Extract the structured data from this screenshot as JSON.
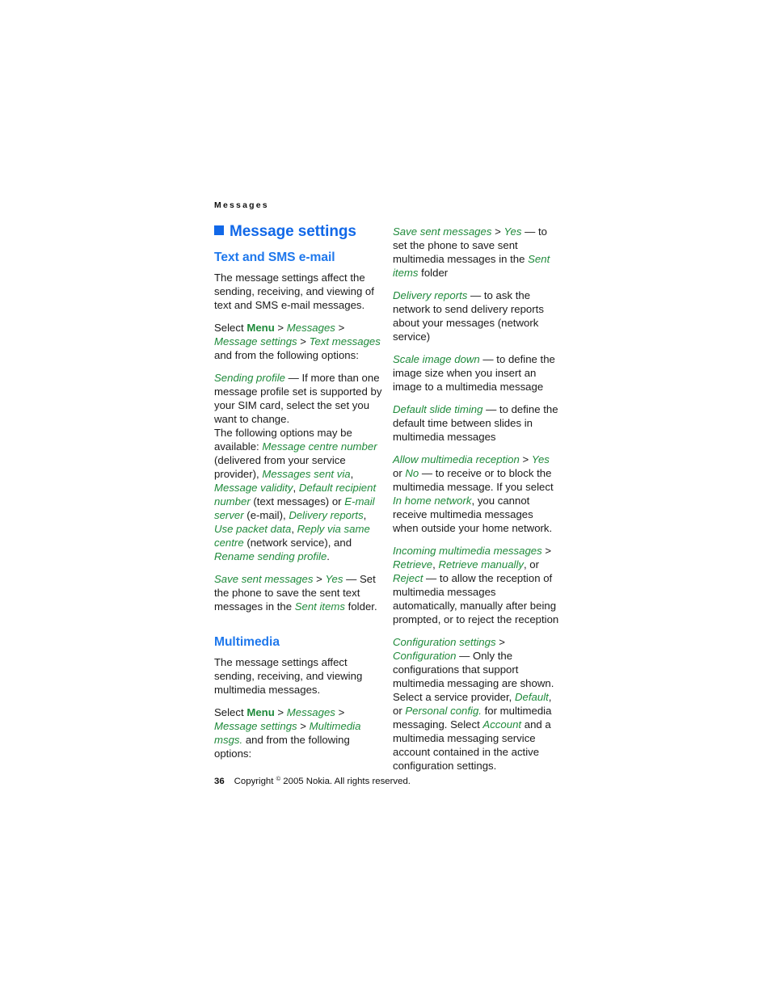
{
  "document": {
    "running_header": "Messages",
    "page_number": "36",
    "copyright": "Copyright © 2005 Nokia. All rights reserved.",
    "copyright_prefix": "Copyright ",
    "copyright_symbol": "©",
    "copyright_suffix": " 2005 Nokia. All rights reserved.",
    "colors": {
      "heading_blue": "#1168e8",
      "subheading_blue": "#1f78ec",
      "menu_green": "#1f8a3b",
      "body_black": "#1a1a1a",
      "page_background": "#ffffff"
    }
  },
  "left_column": {
    "section_title": "Message settings",
    "subsection_1_title": "Text and SMS e-mail",
    "p1": "The message settings affect the sending, receiving, and viewing of text and SMS e-mail messages.",
    "select_line": {
      "select": "Select ",
      "menu": "Menu",
      "sep1": " > ",
      "messages": "Messages",
      "sep2": " > ",
      "message_settings": "Message settings",
      "sep3": " > ",
      "text_messages": "Text messages",
      "tail": " and from the following options:"
    },
    "sending_profile": {
      "term": "Sending profile",
      "body": " — If more than one message profile set is supported by your SIM card, select the set you want to change."
    },
    "following_options": {
      "lead": "The following options may be available: ",
      "o1": "Message centre number",
      "t1": " (delivered from your service provider), ",
      "o2": "Messages sent via",
      "t2": ", ",
      "o3": "Message validity",
      "t3": ", ",
      "o4": "Default recipient number",
      "t4": " (text messages) or ",
      "o5": "E-mail server",
      "t5": " (e-mail), ",
      "o6": "Delivery reports",
      "t6": ", ",
      "o7": "Use packet data",
      "t7": ", ",
      "o8": "Reply via same centre",
      "t8": " (network service), and ",
      "o9": "Rename sending profile",
      "t9": "."
    },
    "save_sent": {
      "term": "Save sent messages",
      "sep": " > ",
      "value": "Yes",
      "body1": " — Set the phone to save the sent text messages in the ",
      "folder": "Sent items",
      "body2": " folder."
    },
    "subsection_2_title": "Multimedia",
    "p2": "The message settings affect sending, receiving, and viewing multimedia messages.",
    "select_line_2": {
      "select": "Select ",
      "menu": "Menu",
      "sep1": " > ",
      "messages": "Messages",
      "sep2": " > ",
      "message_settings": "Message settings",
      "sep3": " > ",
      "multimedia_msgs": "Multimedia msgs.",
      "tail": " and from the following options:"
    }
  },
  "right_column": {
    "save_sent_messages": {
      "term": "Save sent messages",
      "sep": " > ",
      "value": "Yes",
      "body1": " — to set the phone to save sent multimedia messages in the ",
      "folder": "Sent items",
      "body2": " folder"
    },
    "delivery_reports": {
      "term": "Delivery reports",
      "body": " — to ask the network to send delivery reports about your messages (network service)"
    },
    "scale_image_down": {
      "term": "Scale image down",
      "body": " — to define the image size when you insert an image to a multimedia message"
    },
    "default_slide_timing": {
      "term": "Default slide timing",
      "body": " — to define the default time between slides in multimedia messages"
    },
    "allow_multimedia_reception": {
      "term": "Allow multimedia reception",
      "sep": " > ",
      "value1": "Yes",
      "mid": " or ",
      "value2": "No",
      "body1": " — to receive or to block the multimedia message. If you select ",
      "value3": "In home network",
      "body2": ", you cannot receive multimedia messages when outside your home network."
    },
    "incoming_multimedia_messages": {
      "term": "Incoming multimedia messages",
      "sep": " > ",
      "value1": "Retrieve",
      "t1": ", ",
      "value2": "Retrieve manually",
      "t2": ", or ",
      "value3": "Reject",
      "body": " — to allow the reception of multimedia messages automatically, manually after being prompted, or to reject the reception"
    },
    "configuration_settings": {
      "term": "Configuration settings",
      "sep": " > ",
      "value1": "Configuration",
      "body1": " — Only the configurations that support multimedia messaging are shown. Select a service provider, ",
      "value2": "Default",
      "body2": ", or ",
      "value3": "Personal config.",
      "body3": " for multimedia messaging. Select ",
      "value4": "Account",
      "body4": " and a multimedia messaging service account contained in the active configuration settings."
    }
  }
}
